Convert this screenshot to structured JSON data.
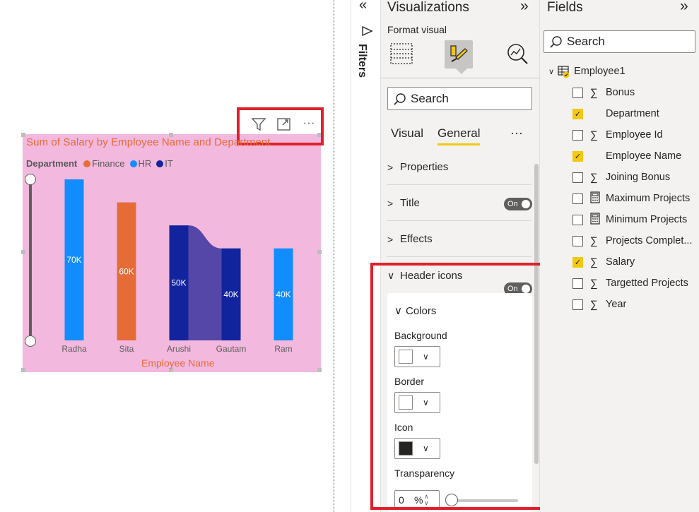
{
  "visual": {
    "header_icons": [
      "filter-icon",
      "focus-mode-icon",
      "more-options-icon"
    ],
    "title": "Sum of Salary by Employee Name and Department",
    "legend_title": "Department",
    "xaxis_title": "Employee Name"
  },
  "chart_data": {
    "type": "bar",
    "title": "Sum of Salary by Employee Name and Department",
    "xlabel": "Employee Name",
    "legend_title": "Department",
    "legend_position": "top-left",
    "categories": [
      "Radha",
      "Sita",
      "Arushi",
      "Gautam",
      "Ram"
    ],
    "series": [
      {
        "name": "Finance",
        "color": "#e66c37",
        "values": [
          null,
          60000,
          null,
          null,
          null
        ],
        "labels": [
          "",
          "60K",
          "",
          "",
          ""
        ]
      },
      {
        "name": "HR",
        "color": "#118dff",
        "values": [
          70000,
          null,
          null,
          null,
          40000
        ],
        "labels": [
          "70K",
          "",
          "",
          "",
          "40K"
        ]
      },
      {
        "name": "IT",
        "color": "#12239e",
        "values": [
          null,
          null,
          50000,
          40000,
          null
        ],
        "labels": [
          "",
          "",
          "50K",
          "40K",
          ""
        ]
      }
    ],
    "ribbon": {
      "from": "Arushi",
      "to": "Gautam",
      "color": "#5547a8"
    },
    "ylim": [
      0,
      70000
    ],
    "grid": false
  },
  "filters": {
    "label": "Filters",
    "collapse_icon": "«"
  },
  "viz_pane": {
    "title": "Visualizations",
    "expand_icon": "»",
    "format_visual_label": "Format visual",
    "search_placeholder": "Search",
    "tabs": [
      "Visual",
      "General"
    ],
    "active_tab": "General",
    "more_label": "···",
    "sections": [
      {
        "label": "Properties",
        "toggle": null,
        "expanded": false
      },
      {
        "label": "Title",
        "toggle": "On",
        "expanded": false
      },
      {
        "label": "Effects",
        "toggle": null,
        "expanded": false
      },
      {
        "label": "Header icons",
        "toggle": "On",
        "expanded": true
      }
    ],
    "colors_group": {
      "label": "Colors",
      "background_label": "Background",
      "background_color": "#ffffff",
      "border_label": "Border",
      "border_color": "#ffffff",
      "icon_label": "Icon",
      "icon_color": "#252423",
      "transparency_label": "Transparency",
      "transparency_value": "0",
      "transparency_unit": "%",
      "transparency_fraction": 0
    }
  },
  "fields_pane": {
    "title": "Fields",
    "expand_icon": "»",
    "search_placeholder": "Search",
    "table_name": "Employee1",
    "fields": [
      {
        "label": "Bonus",
        "icon": "sigma",
        "checked": false
      },
      {
        "label": "Department",
        "icon": "none",
        "checked": true
      },
      {
        "label": "Employee Id",
        "icon": "sigma",
        "checked": false
      },
      {
        "label": "Employee Name",
        "icon": "none",
        "checked": true
      },
      {
        "label": "Joining Bonus",
        "icon": "sigma",
        "checked": false
      },
      {
        "label": "Maximum Projects",
        "icon": "calculator",
        "checked": false
      },
      {
        "label": "Minimum Projects",
        "icon": "calculator",
        "checked": false
      },
      {
        "label": "Projects Complet...",
        "icon": "sigma",
        "checked": false
      },
      {
        "label": "Salary",
        "icon": "sigma",
        "checked": true
      },
      {
        "label": "Targetted Projects",
        "icon": "sigma",
        "checked": false
      },
      {
        "label": "Year",
        "icon": "sigma",
        "checked": false
      }
    ]
  }
}
